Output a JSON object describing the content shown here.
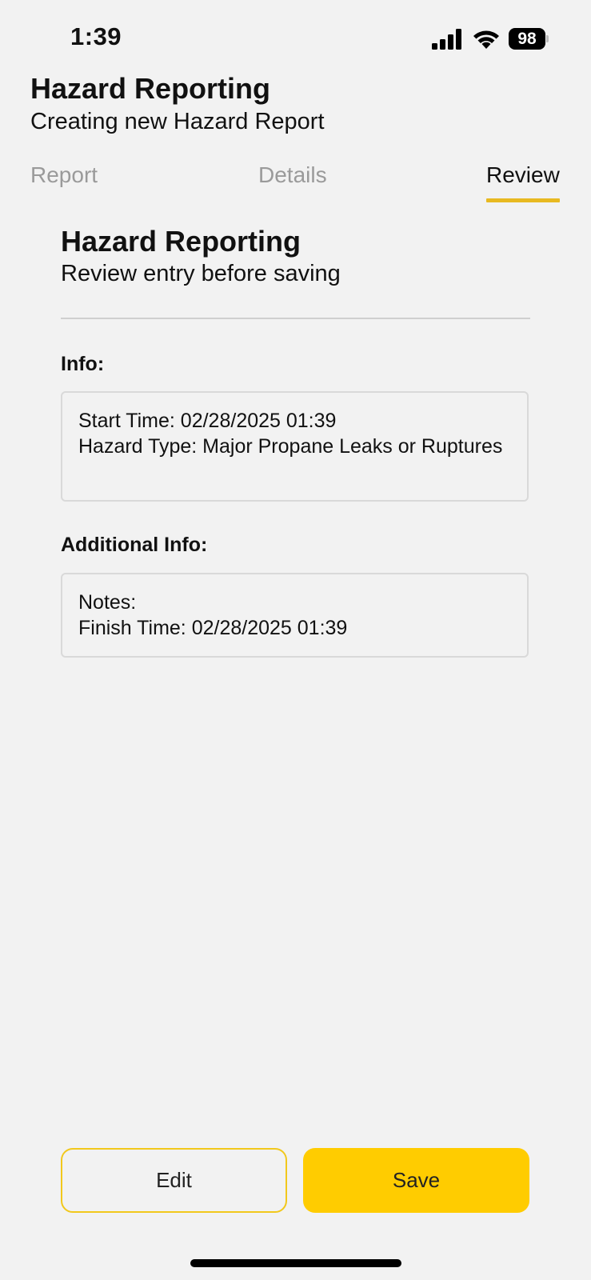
{
  "status_bar": {
    "time": "1:39",
    "battery": "98",
    "icons": [
      "signal-icon",
      "wifi-icon",
      "battery-icon"
    ]
  },
  "header": {
    "title": "Hazard Reporting",
    "subtitle": "Creating new Hazard Report"
  },
  "tabs": [
    {
      "label": "Report",
      "active": false
    },
    {
      "label": "Details",
      "active": false
    },
    {
      "label": "Review",
      "active": true
    }
  ],
  "review": {
    "title": "Hazard Reporting",
    "subtitle": "Review entry before saving",
    "info_label": "Info:",
    "info_lines": [
      "Start Time: 02/28/2025 01:39",
      "Hazard Type: Major Propane Leaks or Ruptures"
    ],
    "additional_label": "Additional Info:",
    "additional_lines": [
      "Notes:",
      "Finish Time: 02/28/2025 01:39"
    ]
  },
  "actions": {
    "edit_label": "Edit",
    "save_label": "Save"
  },
  "colors": {
    "background": "#f2f2f2",
    "accent": "#ffcc00",
    "tab_underline": "#e8b921",
    "inactive_tab": "#9a9a9a"
  }
}
